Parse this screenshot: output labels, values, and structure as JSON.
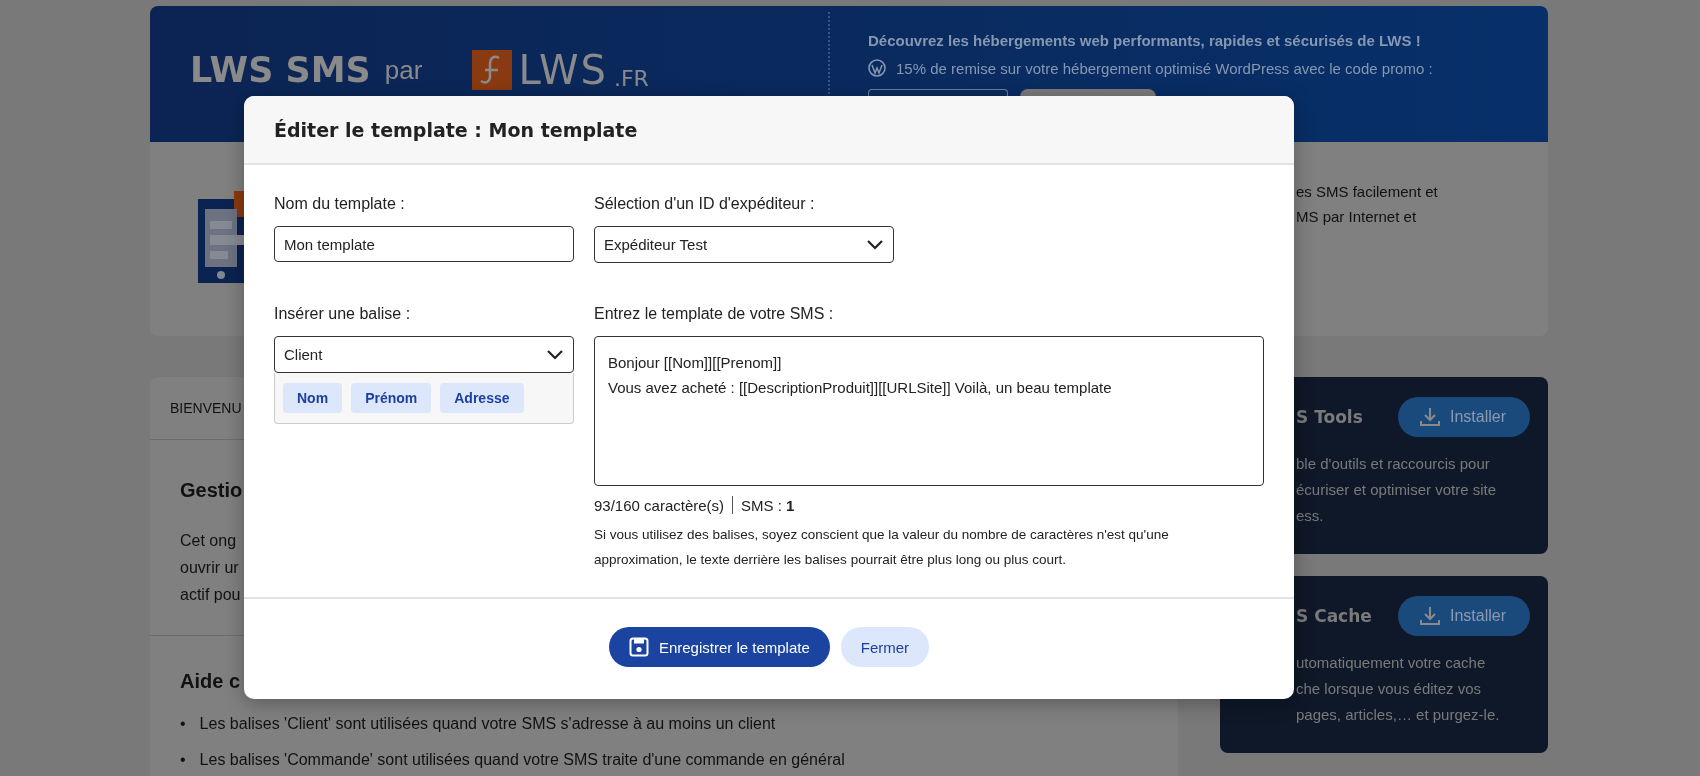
{
  "banner": {
    "title": "LWS SMS",
    "by": "par",
    "logo": {
      "name": "LWS",
      "suffix": ".FR"
    },
    "promo_heading": "Découvrez les hébergements web performants, rapides et sécurisés de LWS !",
    "promo_text": "15% de remise sur votre hébergement optimisé WordPress avec le code promo :"
  },
  "intro_card": {
    "lines": [
      "es SMS facilement et",
      "MS par Internet et"
    ]
  },
  "main_card": {
    "tab": "BIENVENU",
    "sections": [
      {
        "heading": "Gestio",
        "lines": [
          "Cet ong",
          "ouvrir ur",
          "actif pou"
        ]
      },
      {
        "heading": "Aide c",
        "bullets": [
          {
            "marker": "•",
            "text": "Les balises 'Client' sont utilisées quand votre SMS s'adresse à au moins un client"
          },
          {
            "marker": "•",
            "text": "Les balises 'Commande' sont utilisées quand votre SMS traite d'une commande en général"
          }
        ]
      }
    ]
  },
  "plugins": [
    {
      "title": "S Tools",
      "button": "Installer",
      "lines": [
        "ble d'outils et raccourcis pour",
        "écuriser et optimiser votre site",
        "ess."
      ]
    },
    {
      "title": "S Cache",
      "button": "Installer",
      "lines": [
        "utomatiquement votre cache",
        "che lorsque vous éditez vos",
        "pages, articles,… et purgez-le."
      ]
    }
  ],
  "modal": {
    "title": "Éditer le template : Mon template",
    "name_label": "Nom du template :",
    "name_value": "Mon template",
    "sender_label": "Sélection d'un ID d'expéditeur :",
    "sender_value": "Expéditeur Test",
    "tag_label": "Insérer une balise :",
    "tag_value": "Client",
    "tags": [
      "Nom",
      "Prénom",
      "Adresse"
    ],
    "message_label": "Entrez le template de votre SMS :",
    "message_value": "Bonjour [[Nom]][[Prenom]]\nVous avez acheté : [[DescriptionProduit]][[URLSite]] Voilà, un beau template",
    "char_count": "93/160 caractère(s)",
    "sms_count": "SMS : **1**",
    "note": "Si vous utilisez des balises, soyez conscient que la valeur du nombre de caractères n'est qu'une approximation, le texte derrière les balises pourrait être plus long ou plus court.",
    "buttons": [
      {
        "kind": "primary",
        "label": "Enregistrer le template"
      },
      {
        "kind": "secondary",
        "label": "Fermer"
      }
    ]
  }
}
